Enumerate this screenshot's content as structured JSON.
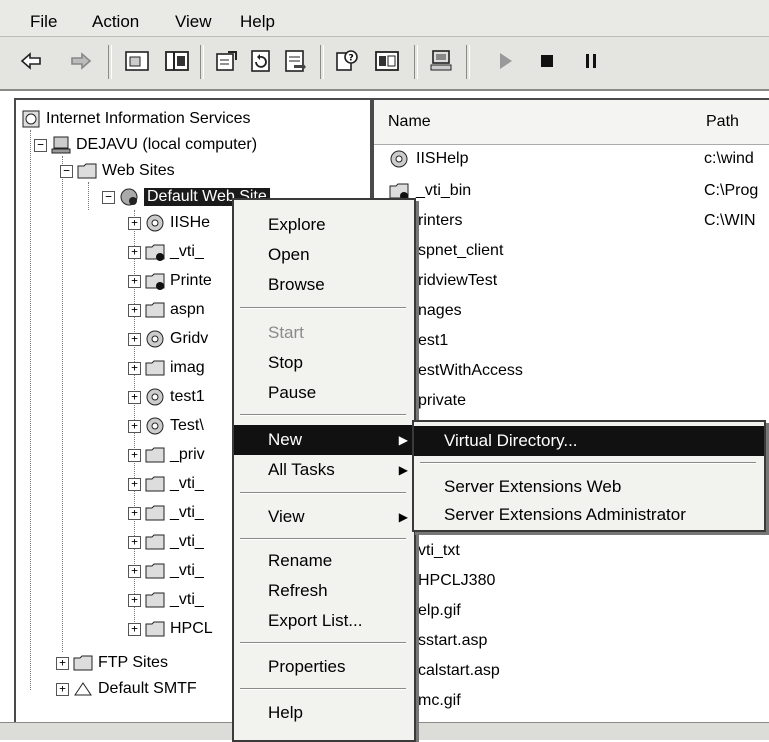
{
  "menubar": {
    "items": [
      "File",
      "Action",
      "View",
      "Help"
    ]
  },
  "toolbar": {
    "buttons": [
      "back-icon",
      "forward-icon",
      "up-folder-icon",
      "show-hide-tree-icon",
      "properties-icon",
      "refresh-icon",
      "export-list-icon",
      "help-icon",
      "console-view-icon",
      "computer-icon",
      "start-icon",
      "stop-icon",
      "pause-icon"
    ]
  },
  "tree": {
    "root": "Internet Information Services",
    "computer": "DEJAVU (local computer)",
    "websites": "Web Sites",
    "default_site": "Default Web Site",
    "children": [
      "IISHe",
      "_vti_",
      "Printe",
      "aspn",
      "Gridv",
      "imag",
      "test1",
      "Test\\",
      "_priv",
      "_vti_",
      "_vti_",
      "_vti_",
      "_vti_",
      "_vti_",
      "HPCL"
    ],
    "ftp": "FTP Sites",
    "smtp": "Default SMTF"
  },
  "list": {
    "col_name": "Name",
    "col_path": "Path",
    "rows": [
      {
        "name": "IISHelp",
        "path": "c:\\wind"
      },
      {
        "name": "_vti_bin",
        "path": "C:\\Prog"
      },
      {
        "name": "rinters",
        "path": "C:\\WIN"
      },
      {
        "name": "spnet_client",
        "path": ""
      },
      {
        "name": "ridviewTest",
        "path": ""
      },
      {
        "name": "nages",
        "path": ""
      },
      {
        "name": "est1",
        "path": ""
      },
      {
        "name": "estWithAccess",
        "path": ""
      },
      {
        "name": "private",
        "path": ""
      },
      {
        "name": "vti_txt",
        "path": ""
      },
      {
        "name": "HPCLJ380",
        "path": ""
      },
      {
        "name": "elp.gif",
        "path": ""
      },
      {
        "name": "sstart.asp",
        "path": ""
      },
      {
        "name": "calstart.asp",
        "path": ""
      },
      {
        "name": "mc.gif",
        "path": ""
      }
    ]
  },
  "context_menu": {
    "explore": "Explore",
    "open": "Open",
    "browse": "Browse",
    "start": "Start",
    "stop": "Stop",
    "pause": "Pause",
    "new": "New",
    "all_tasks": "All Tasks",
    "view": "View",
    "rename": "Rename",
    "refresh": "Refresh",
    "export_list": "Export List...",
    "properties": "Properties",
    "help": "Help"
  },
  "submenu": {
    "virtual_directory": "Virtual Directory...",
    "server_ext_web": "Server Extensions Web",
    "server_ext_admin": "Server Extensions Administrator"
  }
}
